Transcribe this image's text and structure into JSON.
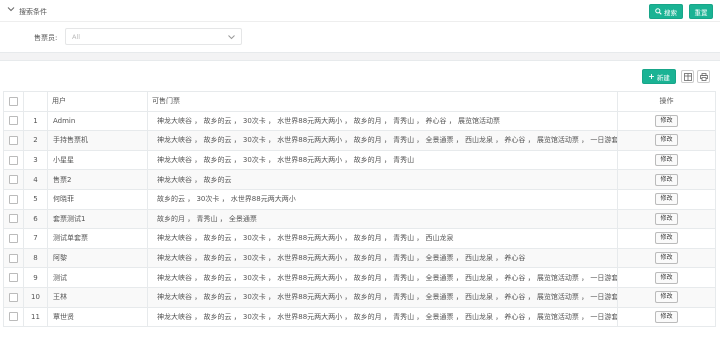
{
  "search": {
    "title": "搜索条件",
    "search_button": "搜索",
    "reset_button": "重置",
    "seller_label": "售票员:",
    "seller_placeholder": "All"
  },
  "toolbar": {
    "new_button": "新建"
  },
  "table": {
    "headers": {
      "user": "用户",
      "tickets": "可售门票",
      "action": "操作"
    },
    "edit_label": "修改",
    "rows": [
      {
        "num": "1",
        "user": "Admin",
        "tickets": "神龙大峡谷 ， 故乡的云 ， 30次卡 ， 水世界88元两大两小 ， 故乡的月 ， 青秀山 ， 养心谷 ， 展览馆活动票"
      },
      {
        "num": "2",
        "user": "手持售票机",
        "tickets": "神龙大峡谷 ， 故乡的云 ， 30次卡 ， 水世界88元两大两小 ， 故乡的月 ， 青秀山 ， 全景通票 ， 西山龙泉 ， 养心谷 ， 展览馆活动票 ， 一日游套票 ，"
      },
      {
        "num": "3",
        "user": "小星星",
        "tickets": "神龙大峡谷 ， 故乡的云 ， 30次卡 ， 水世界88元两大两小 ， 故乡的月 ， 青秀山"
      },
      {
        "num": "4",
        "user": "售票2",
        "tickets": "神龙大峡谷 ， 故乡的云"
      },
      {
        "num": "5",
        "user": "何晓菲",
        "tickets": "故乡的云 ， 30次卡 ， 水世界88元两大两小"
      },
      {
        "num": "6",
        "user": "套票测试1",
        "tickets": "故乡的月 ， 青秀山 ， 全景通票"
      },
      {
        "num": "7",
        "user": "测试单套票",
        "tickets": "神龙大峡谷 ， 故乡的云 ， 30次卡 ， 水世界88元两大两小 ， 故乡的月 ， 青秀山 ， 西山龙泉"
      },
      {
        "num": "8",
        "user": "阿黎",
        "tickets": "神龙大峡谷 ， 故乡的云 ， 30次卡 ， 水世界88元两大两小 ， 故乡的月 ， 青秀山 ， 全景通票 ， 西山龙泉 ， 养心谷"
      },
      {
        "num": "9",
        "user": "测试",
        "tickets": "神龙大峡谷 ， 故乡的云 ， 30次卡 ， 水世界88元两大两小 ， 故乡的月 ， 青秀山 ， 全景通票 ， 西山龙泉 ， 养心谷 ， 展览馆活动票 ， 一日游套票 ，"
      },
      {
        "num": "10",
        "user": "王林",
        "tickets": "神龙大峡谷 ， 故乡的云 ， 30次卡 ， 水世界88元两大两小 ， 故乡的月 ， 青秀山 ， 全景通票 ， 西山龙泉 ， 养心谷 ， 展览馆活动票 ， 一日游套票 ，"
      },
      {
        "num": "11",
        "user": "覃世贤",
        "tickets": "神龙大峡谷 ， 故乡的云 ， 30次卡 ， 水世界88元两大两小 ， 故乡的月 ， 青秀山 ， 全景通票 ， 西山龙泉 ， 养心谷 ， 展览馆活动票 ， 一日游套票 ，"
      }
    ]
  },
  "colors": {
    "accent": "#1ab394",
    "border": "#e7eaec",
    "background": "#f3f3f4"
  },
  "icons": {
    "collapse": "chevron-down-icon",
    "search": "search-icon",
    "new": "plus-icon",
    "columns": "columns-icon",
    "print": "print-icon",
    "select": "caret-down-icon"
  }
}
